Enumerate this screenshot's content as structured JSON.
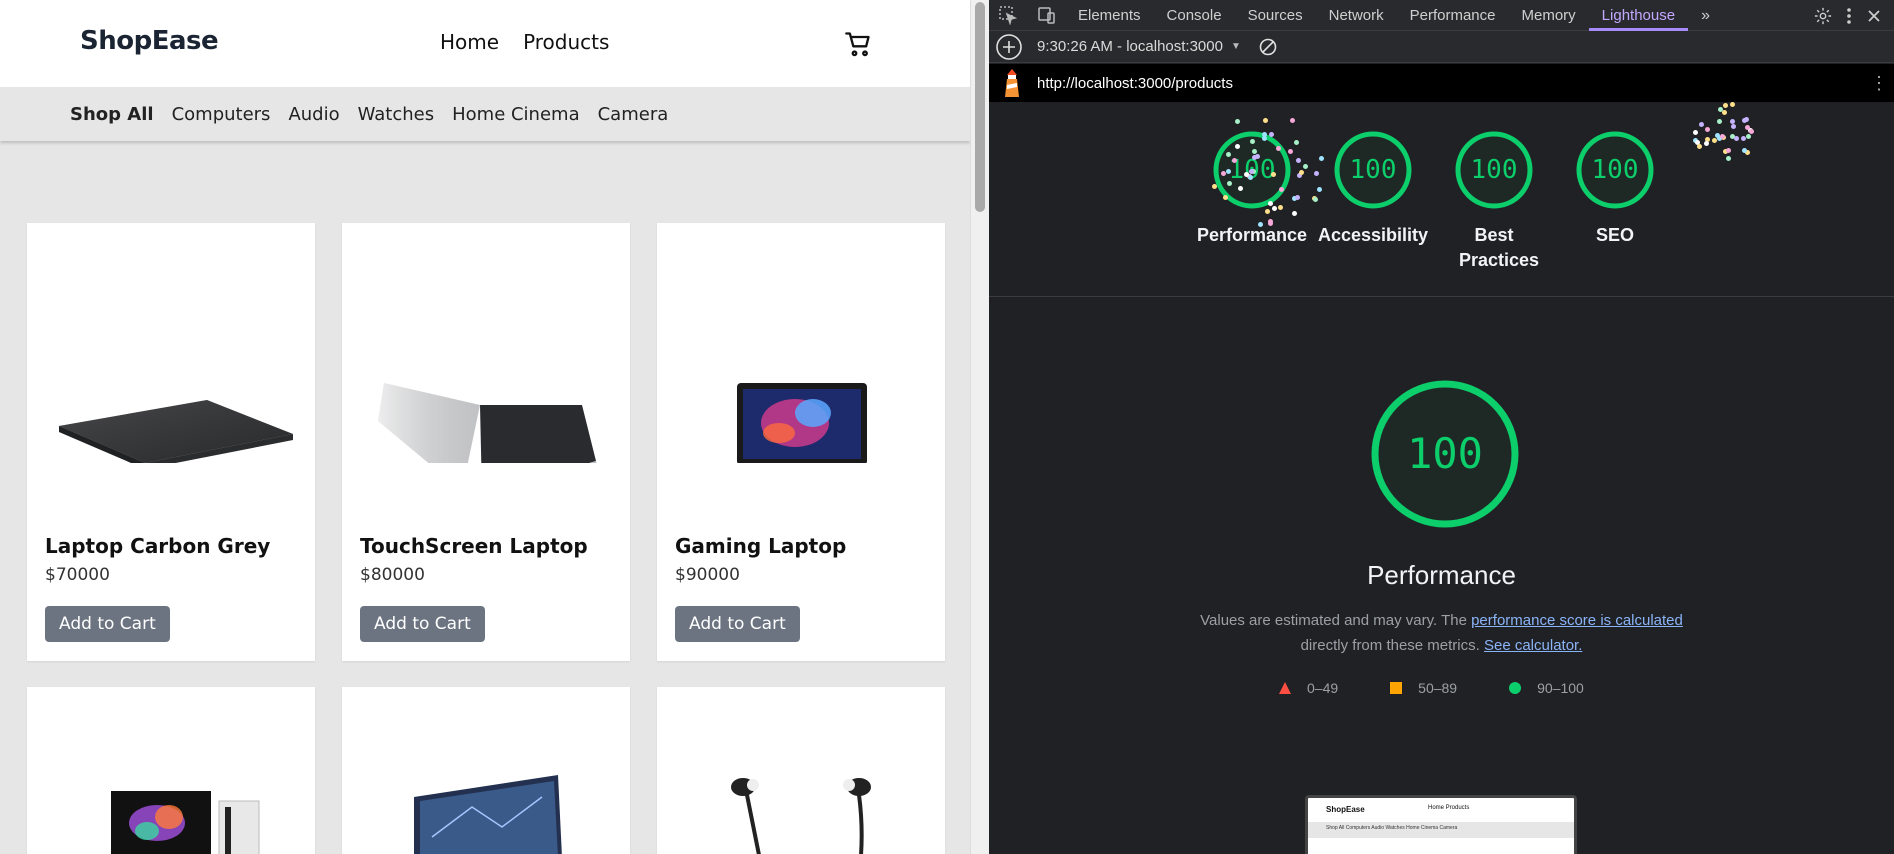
{
  "site": {
    "brand": "ShopEase",
    "nav": [
      "Home",
      "Products"
    ],
    "categories": [
      "Shop All",
      "Computers",
      "Audio",
      "Watches",
      "Home Cinema",
      "Camera"
    ],
    "products": [
      {
        "name": "Laptop Carbon Grey",
        "price": "$70000",
        "button": "Add to Cart"
      },
      {
        "name": "TouchScreen Laptop",
        "price": "$80000",
        "button": "Add to Cart"
      },
      {
        "name": "Gaming Laptop",
        "price": "$90000",
        "button": "Add to Cart"
      }
    ]
  },
  "devtools": {
    "tabs": [
      "Elements",
      "Console",
      "Sources",
      "Network",
      "Performance",
      "Memory",
      "Lighthouse"
    ],
    "active_tab": "Lighthouse",
    "report_time": "9:30:26 AM - localhost:3000",
    "url": "http://localhost:3000/products",
    "scores": [
      {
        "label": "Performance",
        "value": "100"
      },
      {
        "label": "Accessibility",
        "value": "100"
      },
      {
        "label": "Best Practices",
        "value": "100"
      },
      {
        "label": "SEO",
        "value": "100"
      }
    ],
    "big_score": "100",
    "section_title": "Performance",
    "desc_prefix": "Values are estimated and may vary. The ",
    "desc_link1": "performance score is calculated",
    "desc_mid": "directly from these metrics.",
    "desc_link2": "See calculator.",
    "legend": [
      "0–49",
      "50–89",
      "90–100"
    ],
    "thumb": {
      "brand": "ShopEase",
      "nav": "Home   Products",
      "cats": "Shop All  Computers  Audio  Watches  Home Cinema  Camera"
    },
    "colors": {
      "pass": "#0cce6b",
      "average": "#ffa400",
      "fail": "#ff4e42",
      "accent": "#a88bfa"
    }
  }
}
